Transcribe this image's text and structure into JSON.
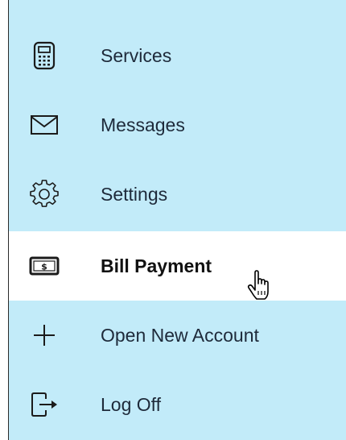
{
  "menu": {
    "items": [
      {
        "label": "Services",
        "icon": "calculator-icon"
      },
      {
        "label": "Messages",
        "icon": "envelope-icon"
      },
      {
        "label": "Settings",
        "icon": "gear-icon"
      },
      {
        "label": "Bill Payment",
        "icon": "dollar-bill-icon",
        "active": true
      },
      {
        "label": "Open New Account",
        "icon": "plus-icon"
      },
      {
        "label": "Log Off",
        "icon": "log-off-icon"
      }
    ]
  },
  "colors": {
    "panel_background": "#c2ebf9",
    "active_background": "#ffffff",
    "text": "#1e2a3a",
    "icon": "#1b1b1b"
  }
}
